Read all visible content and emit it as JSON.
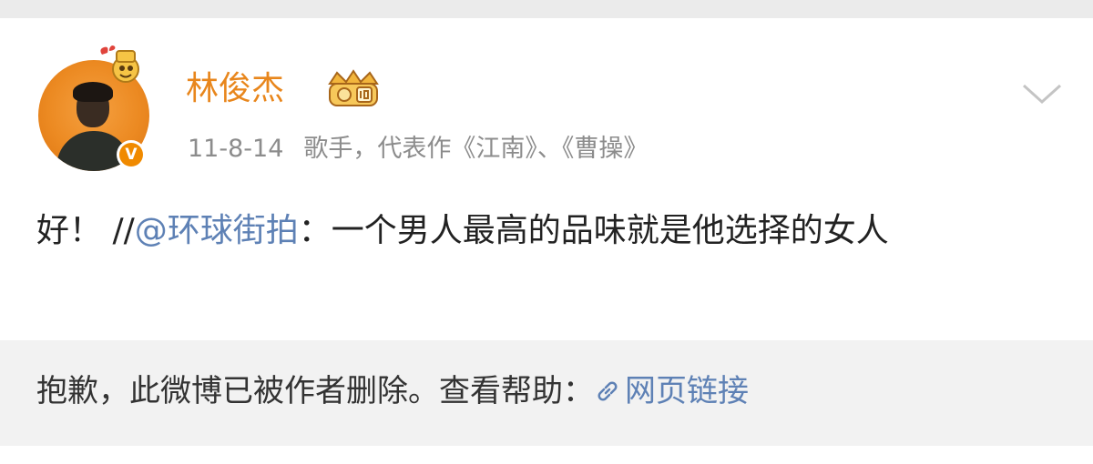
{
  "post": {
    "author": "林俊杰",
    "date": "11-8-14",
    "bio": "歌手，代表作《江南》、《曹操》",
    "text_prefix": "好！ //",
    "mention": "@环球街拍",
    "text_suffix": "：一个男人最高的品味就是他选择的女人"
  },
  "deleted_notice": {
    "message": "抱歉，此微博已被作者删除。查看帮助：",
    "link_label": "网页链接"
  },
  "colors": {
    "username": "#e8861c",
    "mention_link": "#5e81b5",
    "meta_gray": "#8c8c8c",
    "verified_orange": "#f08a00"
  },
  "icons": [
    "verified-v-icon",
    "member-crown-badge-icon",
    "avatar-pendant-icon",
    "chevron-down-icon",
    "link-chain-icon"
  ]
}
